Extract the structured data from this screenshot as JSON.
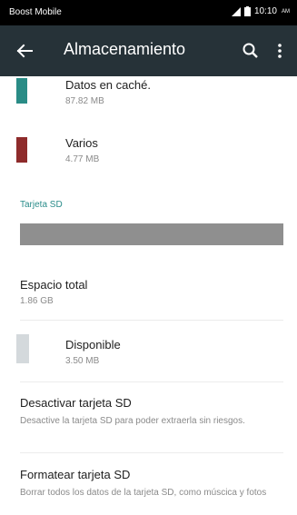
{
  "status_bar": {
    "carrier": "Boost Mobile",
    "time": "10:10",
    "ampm": "AM"
  },
  "app_bar": {
    "title": "Almacenamiento",
    "icons": [
      "back-arrow-icon",
      "search-icon",
      "overflow-menu-icon"
    ]
  },
  "storage_items": [
    {
      "label": "Datos en caché.",
      "size": "87.82 MB",
      "color": "#2a8c86"
    },
    {
      "label": "Varios",
      "size": "4.77 MB",
      "color": "#8e2b2b"
    }
  ],
  "sd_card": {
    "header": "Tarjeta SD",
    "header_color": "#2a8c8a",
    "total_label": "Espacio total",
    "total_value": "1.86 GB",
    "available_label": "Disponible",
    "available_value": "3.50 MB",
    "available_color": "#d4d9dc",
    "bar_color": "#8f8f8f"
  },
  "actions": [
    {
      "title": "Desactivar tarjeta SD",
      "description": "Desactive la tarjeta SD para poder extraerla sin riesgos."
    },
    {
      "title": "Formatear tarjeta SD",
      "description": "Borrar todos los datos de la tarjeta SD, como múscica y fotos"
    }
  ],
  "colors": {
    "status_bar": "#000000",
    "app_bar": "#263238",
    "accent": "#2a8c8a"
  }
}
